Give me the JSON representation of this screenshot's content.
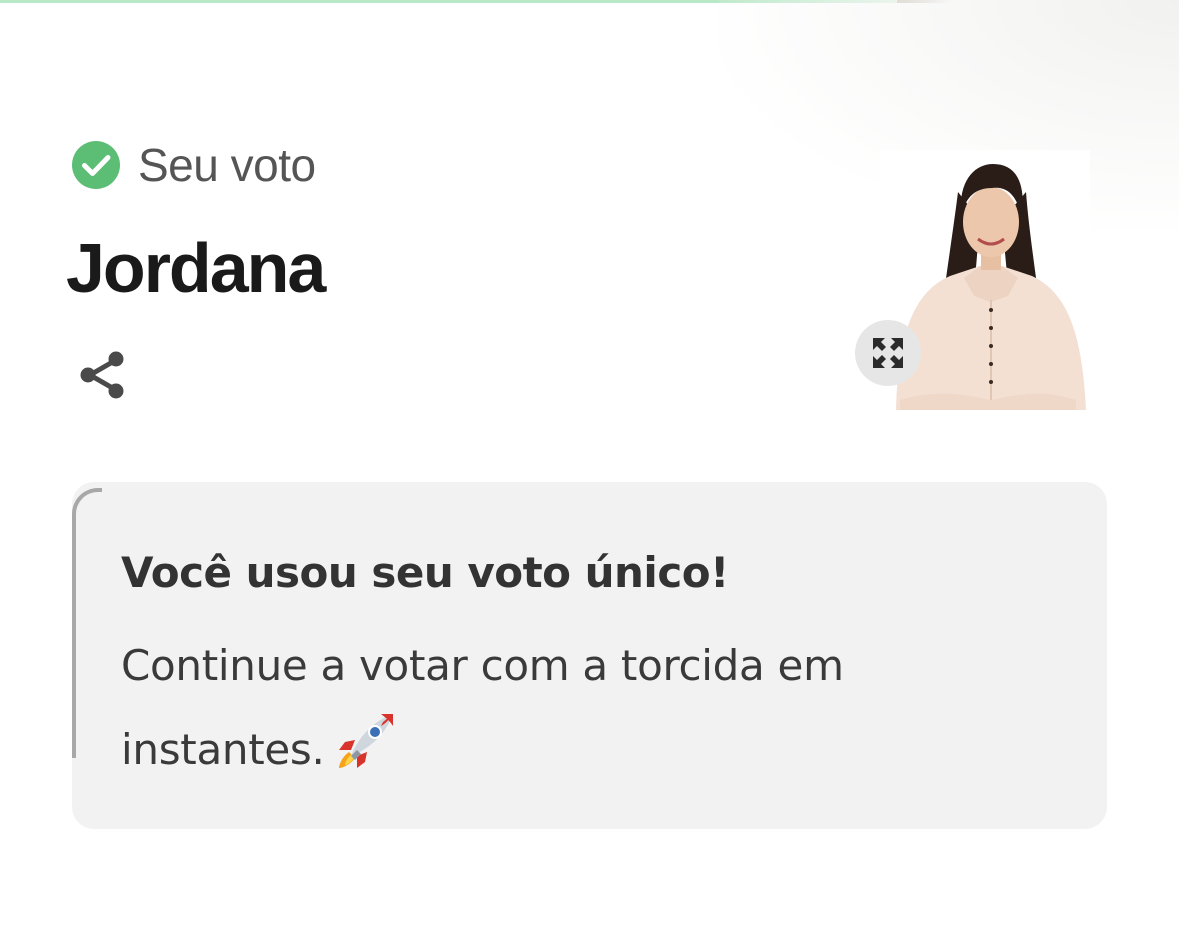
{
  "vote_status": {
    "label": "Seu voto",
    "icon": "check-circle-icon",
    "icon_color": "#5cbd74"
  },
  "candidate": {
    "name": "Jordana",
    "photo": "candidate-photo"
  },
  "actions": {
    "share_icon": "share-icon",
    "expand_icon": "expand-icon"
  },
  "message": {
    "title": "Você usou seu voto único!",
    "body": "Continue a votar com a torcida em instantes.",
    "emoji_icon": "rocket-icon"
  },
  "colors": {
    "accent_green": "#5cbd74",
    "top_bar": "#b9e8c6",
    "card_background": "#f2f2f2"
  }
}
